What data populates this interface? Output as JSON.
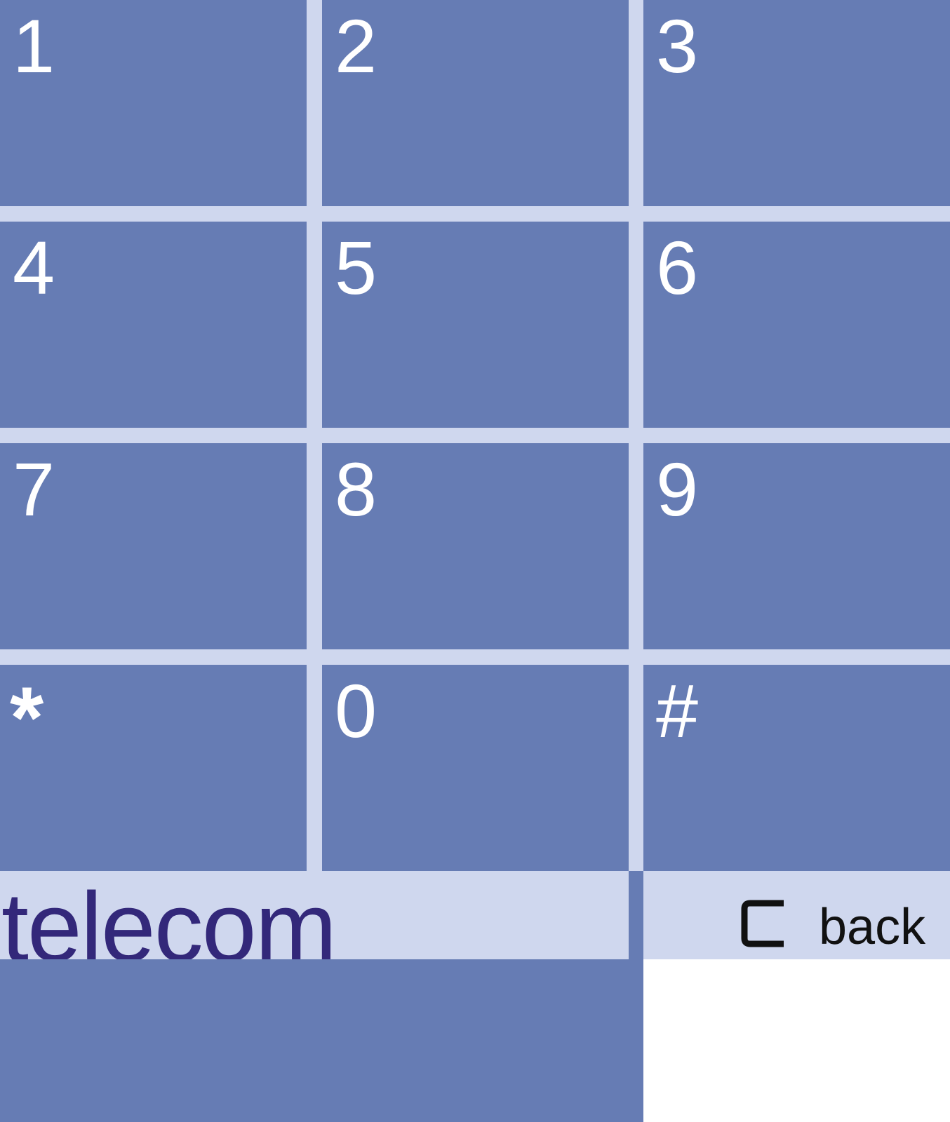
{
  "keypad": {
    "keys": [
      {
        "label": "1"
      },
      {
        "label": "2"
      },
      {
        "label": "3"
      },
      {
        "label": "4"
      },
      {
        "label": "5"
      },
      {
        "label": "6"
      },
      {
        "label": "7"
      },
      {
        "label": "8"
      },
      {
        "label": "9"
      },
      {
        "label": "*"
      },
      {
        "label": "0"
      },
      {
        "label": "#"
      }
    ]
  },
  "brand": {
    "text": "telecom"
  },
  "back_button": {
    "label": "back",
    "icon": "clear-icon"
  },
  "colors": {
    "key_blue": "#667cb4",
    "gap_light": "#cfd7ee",
    "brand_purple": "#33287a",
    "label_white": "#ffffff"
  }
}
